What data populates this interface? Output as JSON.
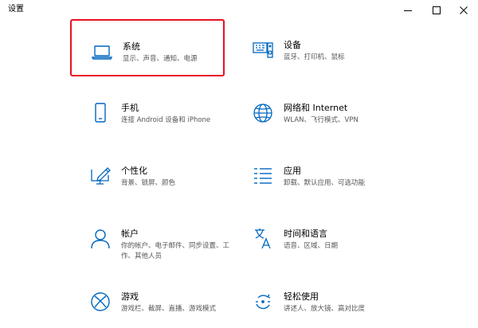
{
  "window": {
    "title": "设置"
  },
  "colors": {
    "accent": "#0067c0",
    "selection_border": "#e81123",
    "description_text": "#555555"
  },
  "tiles": [
    {
      "id": "system",
      "label": "系统",
      "description": "显示、声音、通知、电源",
      "icon": "laptop-icon",
      "selected": true
    },
    {
      "id": "devices",
      "label": "设备",
      "description": "蓝牙、打印机、鼠标",
      "icon": "keyboard-speaker-icon"
    },
    {
      "id": "phone",
      "label": "手机",
      "description": "连接 Android 设备和 iPhone",
      "icon": "phone-icon"
    },
    {
      "id": "network",
      "label": "网络和 Internet",
      "description": "WLAN、飞行模式、VPN",
      "icon": "globe-icon"
    },
    {
      "id": "personalization",
      "label": "个性化",
      "description": "背景、锁屏、颜色",
      "icon": "pen-monitor-icon"
    },
    {
      "id": "apps",
      "label": "应用",
      "description": "卸载、默认应用、可选功能",
      "icon": "apps-list-icon"
    },
    {
      "id": "accounts",
      "label": "帐户",
      "description": "你的帐户、电子邮件、同步设置、工作、其他人员",
      "icon": "person-icon"
    },
    {
      "id": "time-language",
      "label": "时间和语言",
      "description": "语音、区域、日期",
      "icon": "time-language-icon"
    },
    {
      "id": "gaming",
      "label": "游戏",
      "description": "游戏栏、截屏、直播、游戏模式",
      "icon": "xbox-icon"
    },
    {
      "id": "ease-of-access",
      "label": "轻松使用",
      "description": "讲述人、放大镜、高对比度",
      "icon": "ease-of-access-icon"
    }
  ]
}
